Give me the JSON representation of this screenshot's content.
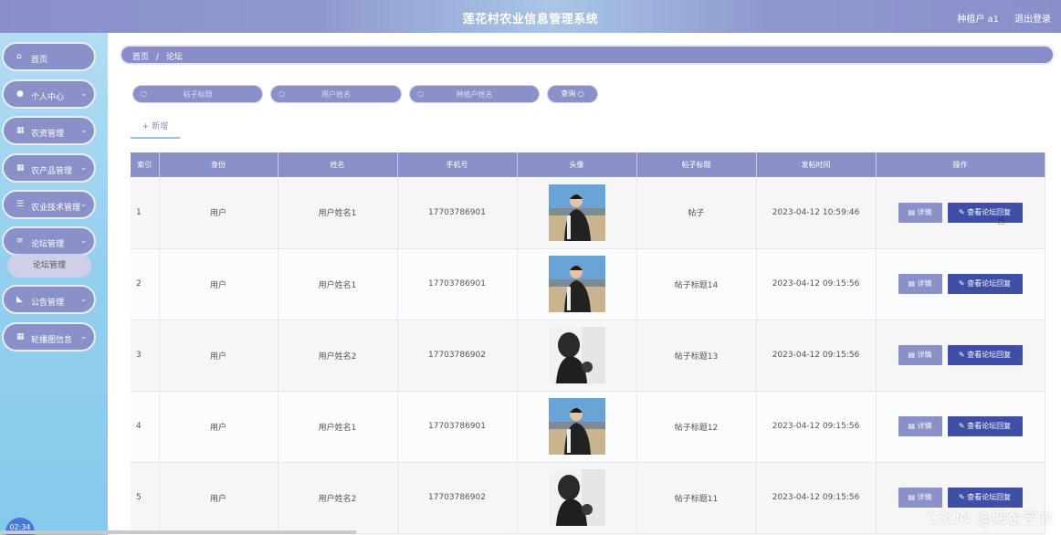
{
  "header": {
    "title": "莲花村农业信息管理系统",
    "user": "种植户 a1",
    "logout_label": "退出登录"
  },
  "sidebar": {
    "items": [
      {
        "label": "首页",
        "icon": "home-icon",
        "glyph": "⌂",
        "expandable": false
      },
      {
        "label": "个人中心",
        "icon": "user-icon",
        "glyph": "●",
        "expandable": true
      },
      {
        "label": "农资管理",
        "icon": "grid-icon",
        "glyph": "▦",
        "expandable": true
      },
      {
        "label": "农产品管理",
        "icon": "grid-icon",
        "glyph": "▦",
        "expandable": true
      },
      {
        "label": "农业技术管理",
        "icon": "sliders-icon",
        "glyph": "☰",
        "expandable": true
      },
      {
        "label": "论坛管理",
        "icon": "list-icon",
        "glyph": "≡",
        "expandable": true
      },
      {
        "label": "公告管理",
        "icon": "megaphone-icon",
        "glyph": "◣",
        "expandable": true
      },
      {
        "label": "轮播图信息",
        "icon": "grid-icon",
        "glyph": "▦",
        "expandable": true
      }
    ],
    "sub_item": "论坛管理"
  },
  "breadcrumb": {
    "home": "首页",
    "separator": "/",
    "current": "论坛"
  },
  "search": {
    "placeholders": [
      "帖子标题",
      "用户姓名",
      "种植户姓名"
    ],
    "button_label": "查询"
  },
  "toolbar": {
    "add_label": "+ 新增"
  },
  "table": {
    "columns": [
      "索引",
      "身份",
      "姓名",
      "手机号",
      "头像",
      "帖子标题",
      "发帖时间",
      "操作"
    ],
    "rows": [
      {
        "index": "1",
        "role": "用户",
        "name": "用户姓名1",
        "phone": "17703786901",
        "avatar": "outdoor",
        "title": "帖子",
        "time": "2023-04-12 10:59:46"
      },
      {
        "index": "2",
        "role": "用户",
        "name": "用户姓名1",
        "phone": "17703786901",
        "avatar": "outdoor",
        "title": "帖子标题14",
        "time": "2023-04-12 09:15:56"
      },
      {
        "index": "3",
        "role": "用户",
        "name": "用户姓名2",
        "phone": "17703786902",
        "avatar": "mono",
        "title": "帖子标题13",
        "time": "2023-04-12 09:15:56"
      },
      {
        "index": "4",
        "role": "用户",
        "name": "用户姓名1",
        "phone": "17703786901",
        "avatar": "outdoor",
        "title": "帖子标题12",
        "time": "2023-04-12 09:15:56"
      },
      {
        "index": "5",
        "role": "用户",
        "name": "用户姓名2",
        "phone": "17703786902",
        "avatar": "mono",
        "title": "帖子标题11",
        "time": "2023-04-12 09:15:56"
      }
    ],
    "detail_label": "详情",
    "reply_label": "查看论坛回复"
  },
  "clock": "02:34",
  "watermark": "CSDN @四金学长",
  "colors": {
    "accent": "#8a90c8",
    "primary_button": "#3f4fa6",
    "sidebar": "#94d0ee"
  }
}
